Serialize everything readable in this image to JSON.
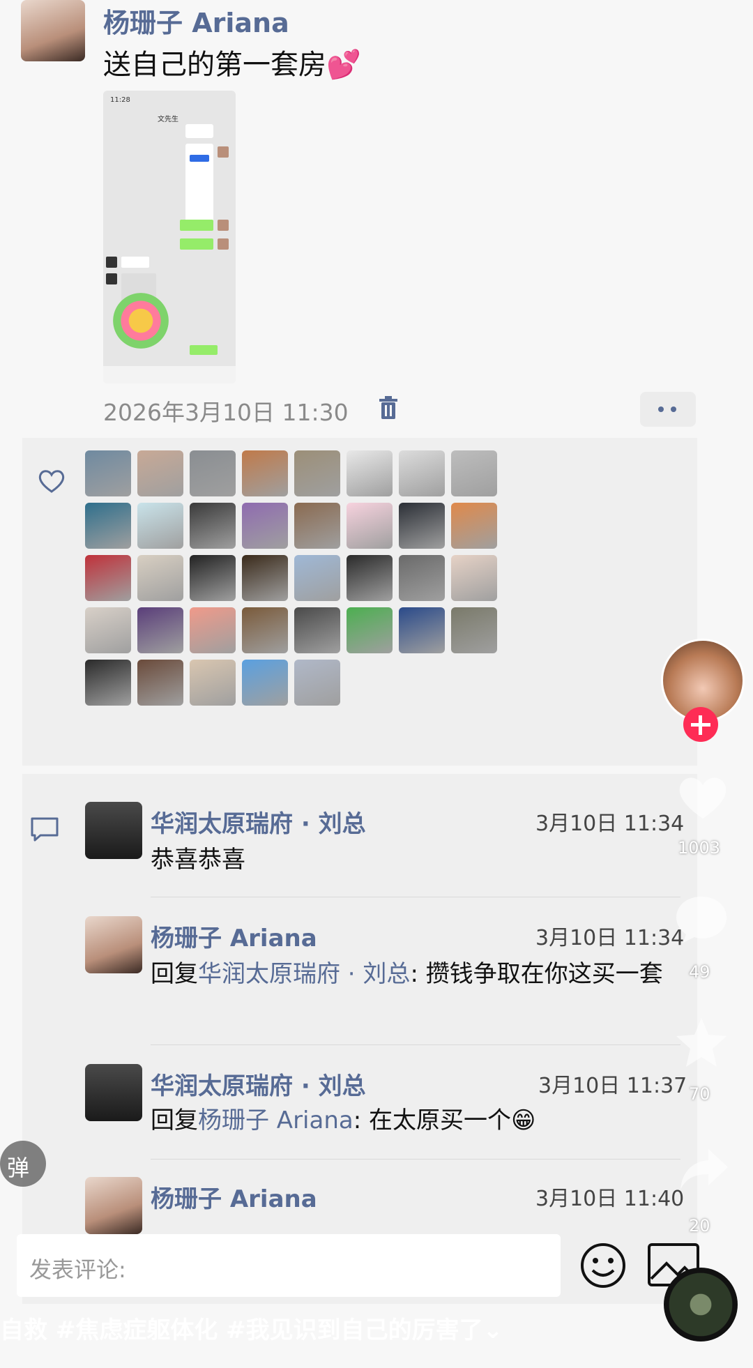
{
  "post": {
    "author": "杨珊子 Ariana",
    "text": "送自己的第一套房💕",
    "timestamp": "2026年3月10日 11:30",
    "image_time": "11:28",
    "image_title": "文先生"
  },
  "like_avatars_count": 37,
  "comments": [
    {
      "author": "华润太原瑞府 · 刘总",
      "time": "3月10日 11:34",
      "text": "恭喜恭喜",
      "reply_to": ""
    },
    {
      "author": "杨珊子 Ariana",
      "time": "3月10日 11:34",
      "reply_prefix": "回复",
      "reply_to": "华润太原瑞府 · 刘总",
      "text": ": 攒钱争取在你这买一套"
    },
    {
      "author": "华润太原瑞府 · 刘总",
      "time": "3月10日 11:37",
      "reply_prefix": "回复",
      "reply_to": "杨珊子 Ariana",
      "text": ": 在太原买一个😁"
    },
    {
      "author": "杨珊子 Ariana",
      "time": "3月10日 11:40",
      "text": "",
      "reply_to": ""
    }
  ],
  "input": {
    "placeholder": "发表评论:"
  },
  "danmaku_label": "弹",
  "side": {
    "like_count": "1003",
    "comment_count": "49",
    "fav_count": "70",
    "share_count": "20"
  },
  "overlay": {
    "hashtags": "自救 #焦虑症躯体化 #我见识到自己的厉害了⌄"
  },
  "colors": {
    "link": "#576b95",
    "follow": "#fe2c55"
  }
}
